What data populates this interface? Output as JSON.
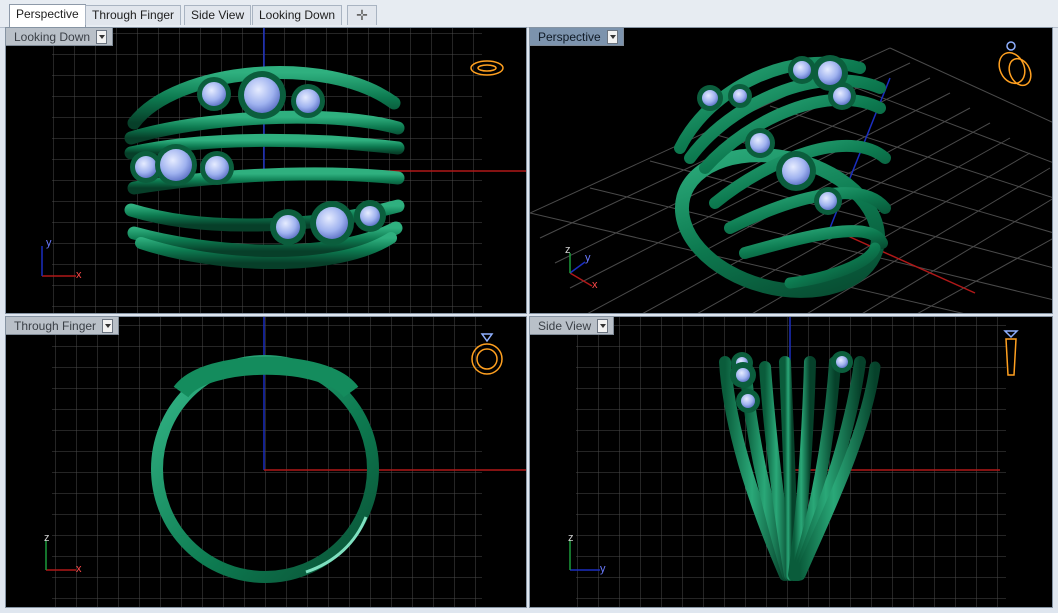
{
  "tabs": [
    {
      "label": "Perspective",
      "active": true
    },
    {
      "label": "Through Finger",
      "active": false
    },
    {
      "label": "Side View",
      "active": false
    },
    {
      "label": "Looking Down",
      "active": false
    }
  ],
  "add_tab_symbol": "✛",
  "viewports": {
    "top_left": {
      "title": "Looking Down",
      "axis_labels": [
        "y",
        "x"
      ],
      "active": false
    },
    "top_right": {
      "title": "Perspective",
      "axis_labels": [
        "z",
        "y",
        "x"
      ],
      "active": true
    },
    "bottom_left": {
      "title": "Through Finger",
      "axis_labels": [
        "z",
        "x"
      ],
      "active": false
    },
    "bottom_right": {
      "title": "Side View",
      "axis_labels": [
        "z",
        "y"
      ],
      "active": false
    }
  },
  "colors": {
    "background": "#000000",
    "grid": "#4d4d4d",
    "axis_x": "#b01818",
    "axis_y": "#1a2ec0",
    "ring_metal": "#0f7a52",
    "gemstone": "#a6b8f2",
    "nav_widget": "#ffa020",
    "active_title": "#7c93ad"
  },
  "icons": {
    "viewport_menu": "dropdown-arrow-icon",
    "view_cube": "ring-navigation-icon",
    "add_tab": "plus-icon"
  }
}
